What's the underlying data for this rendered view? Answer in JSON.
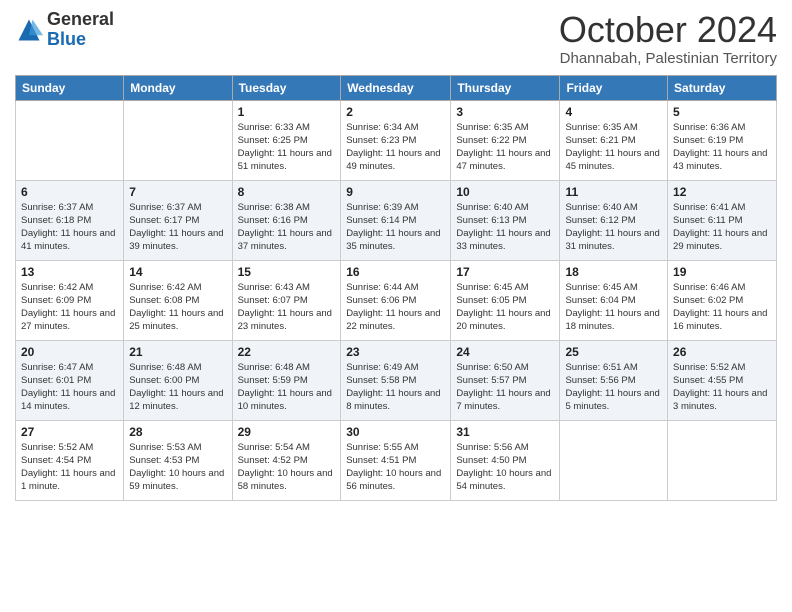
{
  "header": {
    "logo": {
      "general": "General",
      "blue": "Blue"
    },
    "title": "October 2024",
    "subtitle": "Dhannabah, Palestinian Territory"
  },
  "weekdays": [
    "Sunday",
    "Monday",
    "Tuesday",
    "Wednesday",
    "Thursday",
    "Friday",
    "Saturday"
  ],
  "weeks": [
    [
      null,
      null,
      {
        "day": 1,
        "sunrise": "6:33 AM",
        "sunset": "6:25 PM",
        "daylight": "11 hours and 51 minutes."
      },
      {
        "day": 2,
        "sunrise": "6:34 AM",
        "sunset": "6:23 PM",
        "daylight": "11 hours and 49 minutes."
      },
      {
        "day": 3,
        "sunrise": "6:35 AM",
        "sunset": "6:22 PM",
        "daylight": "11 hours and 47 minutes."
      },
      {
        "day": 4,
        "sunrise": "6:35 AM",
        "sunset": "6:21 PM",
        "daylight": "11 hours and 45 minutes."
      },
      {
        "day": 5,
        "sunrise": "6:36 AM",
        "sunset": "6:19 PM",
        "daylight": "11 hours and 43 minutes."
      }
    ],
    [
      {
        "day": 6,
        "sunrise": "6:37 AM",
        "sunset": "6:18 PM",
        "daylight": "11 hours and 41 minutes."
      },
      {
        "day": 7,
        "sunrise": "6:37 AM",
        "sunset": "6:17 PM",
        "daylight": "11 hours and 39 minutes."
      },
      {
        "day": 8,
        "sunrise": "6:38 AM",
        "sunset": "6:16 PM",
        "daylight": "11 hours and 37 minutes."
      },
      {
        "day": 9,
        "sunrise": "6:39 AM",
        "sunset": "6:14 PM",
        "daylight": "11 hours and 35 minutes."
      },
      {
        "day": 10,
        "sunrise": "6:40 AM",
        "sunset": "6:13 PM",
        "daylight": "11 hours and 33 minutes."
      },
      {
        "day": 11,
        "sunrise": "6:40 AM",
        "sunset": "6:12 PM",
        "daylight": "11 hours and 31 minutes."
      },
      {
        "day": 12,
        "sunrise": "6:41 AM",
        "sunset": "6:11 PM",
        "daylight": "11 hours and 29 minutes."
      }
    ],
    [
      {
        "day": 13,
        "sunrise": "6:42 AM",
        "sunset": "6:09 PM",
        "daylight": "11 hours and 27 minutes."
      },
      {
        "day": 14,
        "sunrise": "6:42 AM",
        "sunset": "6:08 PM",
        "daylight": "11 hours and 25 minutes."
      },
      {
        "day": 15,
        "sunrise": "6:43 AM",
        "sunset": "6:07 PM",
        "daylight": "11 hours and 23 minutes."
      },
      {
        "day": 16,
        "sunrise": "6:44 AM",
        "sunset": "6:06 PM",
        "daylight": "11 hours and 22 minutes."
      },
      {
        "day": 17,
        "sunrise": "6:45 AM",
        "sunset": "6:05 PM",
        "daylight": "11 hours and 20 minutes."
      },
      {
        "day": 18,
        "sunrise": "6:45 AM",
        "sunset": "6:04 PM",
        "daylight": "11 hours and 18 minutes."
      },
      {
        "day": 19,
        "sunrise": "6:46 AM",
        "sunset": "6:02 PM",
        "daylight": "11 hours and 16 minutes."
      }
    ],
    [
      {
        "day": 20,
        "sunrise": "6:47 AM",
        "sunset": "6:01 PM",
        "daylight": "11 hours and 14 minutes."
      },
      {
        "day": 21,
        "sunrise": "6:48 AM",
        "sunset": "6:00 PM",
        "daylight": "11 hours and 12 minutes."
      },
      {
        "day": 22,
        "sunrise": "6:48 AM",
        "sunset": "5:59 PM",
        "daylight": "11 hours and 10 minutes."
      },
      {
        "day": 23,
        "sunrise": "6:49 AM",
        "sunset": "5:58 PM",
        "daylight": "11 hours and 8 minutes."
      },
      {
        "day": 24,
        "sunrise": "6:50 AM",
        "sunset": "5:57 PM",
        "daylight": "11 hours and 7 minutes."
      },
      {
        "day": 25,
        "sunrise": "6:51 AM",
        "sunset": "5:56 PM",
        "daylight": "11 hours and 5 minutes."
      },
      {
        "day": 26,
        "sunrise": "5:52 AM",
        "sunset": "4:55 PM",
        "daylight": "11 hours and 3 minutes."
      }
    ],
    [
      {
        "day": 27,
        "sunrise": "5:52 AM",
        "sunset": "4:54 PM",
        "daylight": "11 hours and 1 minute."
      },
      {
        "day": 28,
        "sunrise": "5:53 AM",
        "sunset": "4:53 PM",
        "daylight": "10 hours and 59 minutes."
      },
      {
        "day": 29,
        "sunrise": "5:54 AM",
        "sunset": "4:52 PM",
        "daylight": "10 hours and 58 minutes."
      },
      {
        "day": 30,
        "sunrise": "5:55 AM",
        "sunset": "4:51 PM",
        "daylight": "10 hours and 56 minutes."
      },
      {
        "day": 31,
        "sunrise": "5:56 AM",
        "sunset": "4:50 PM",
        "daylight": "10 hours and 54 minutes."
      },
      null,
      null
    ]
  ]
}
